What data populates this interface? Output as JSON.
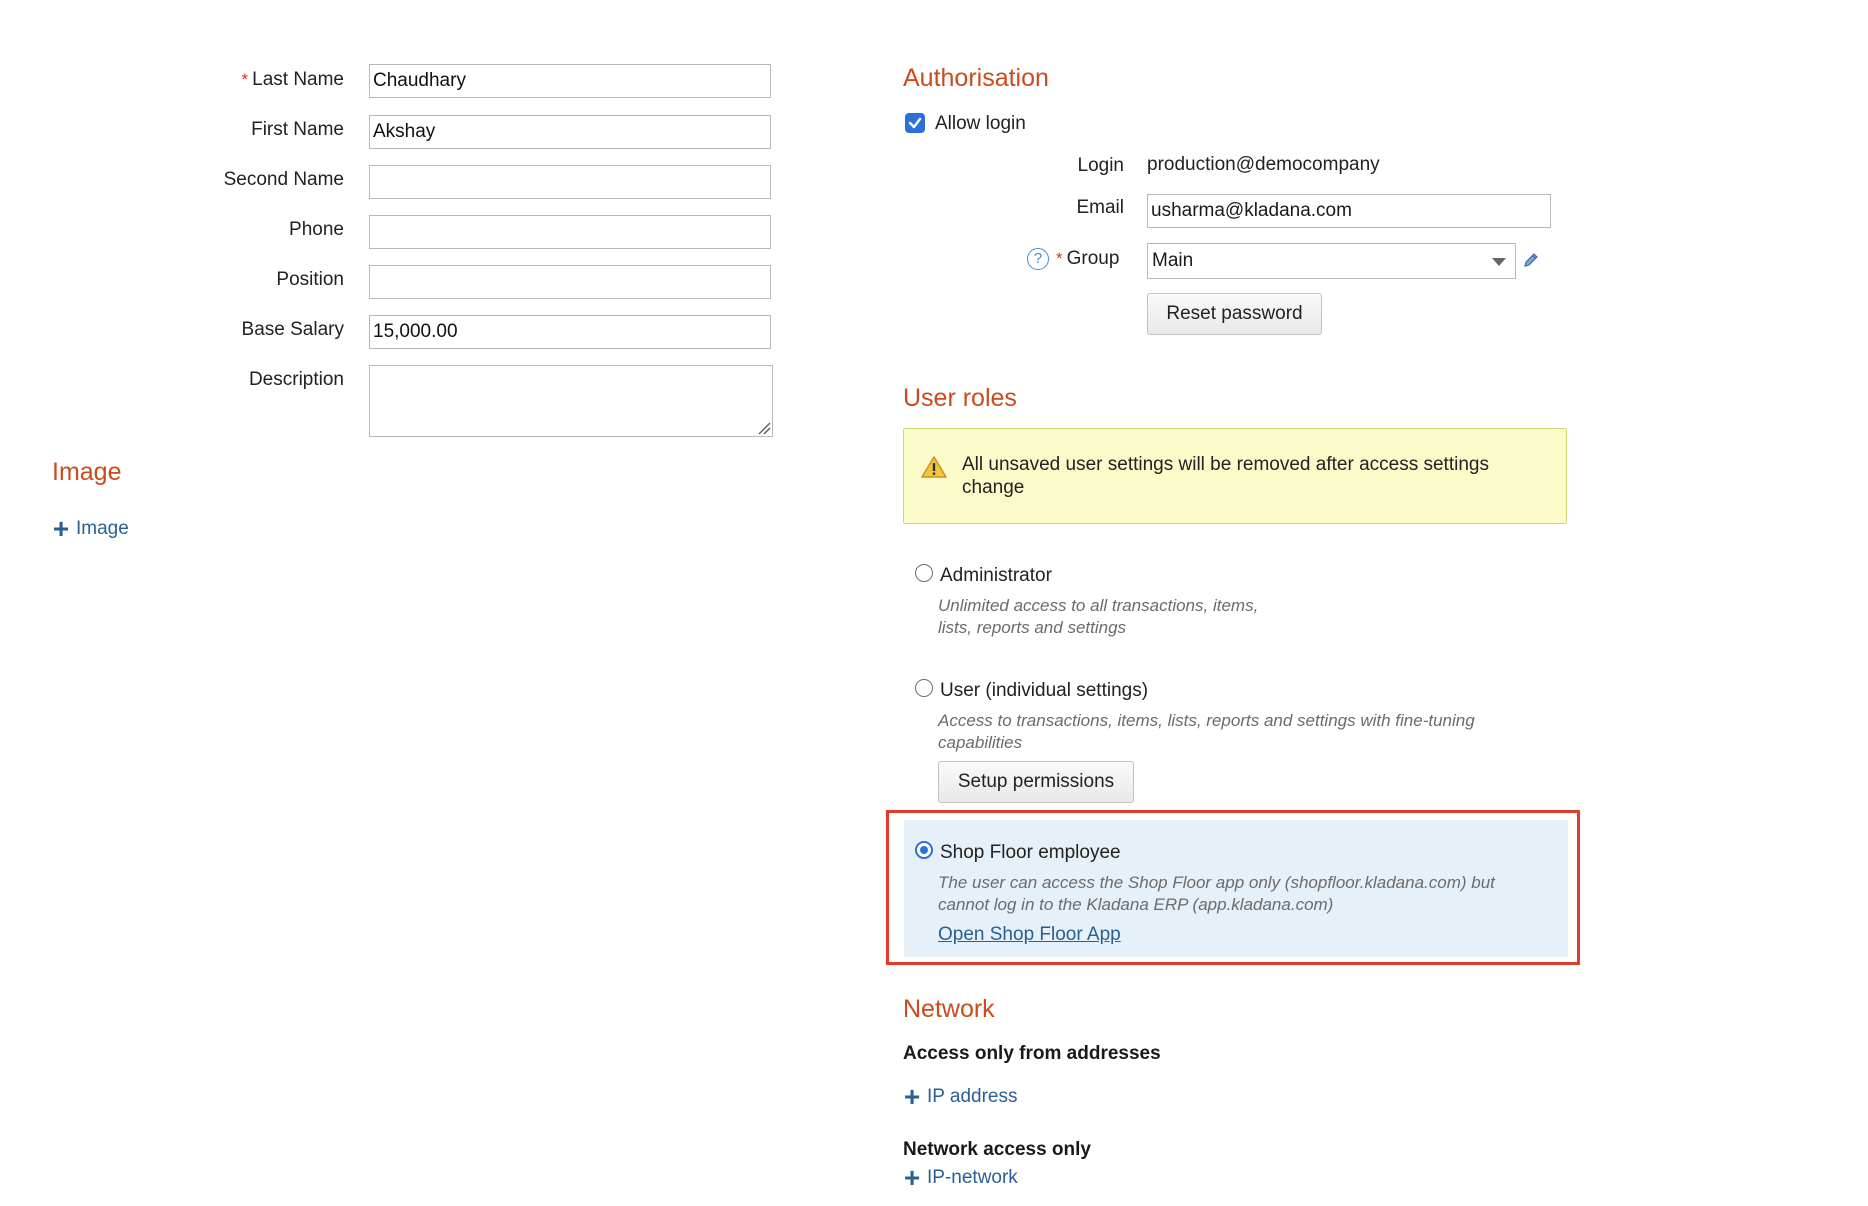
{
  "employee_form": {
    "last_name": {
      "label": "Last Name",
      "required_mark": "*",
      "value": "Chaudhary"
    },
    "first_name": {
      "label": "First Name",
      "value": "Akshay"
    },
    "second_name": {
      "label": "Second Name",
      "value": ""
    },
    "phone": {
      "label": "Phone",
      "value": ""
    },
    "position": {
      "label": "Position",
      "value": ""
    },
    "base_salary": {
      "label": "Base Salary",
      "value": "15,000.00"
    },
    "description": {
      "label": "Description",
      "value": ""
    }
  },
  "image_section": {
    "title": "Image",
    "add_label": "Image",
    "add_icon": "plus-icon"
  },
  "authorisation": {
    "title": "Authorisation",
    "allow_login": {
      "label": "Allow login",
      "checked": true
    },
    "login": {
      "label": "Login",
      "value": "production@democompany"
    },
    "email": {
      "label": "Email",
      "value": "usharma@kladana.com"
    },
    "group": {
      "label": "Group",
      "required_mark": "*",
      "selected": "Main",
      "help_icon": "question-circle-icon",
      "edit_icon": "pencil-icon"
    },
    "reset_password_label": "Reset password"
  },
  "user_roles": {
    "title": "User roles",
    "warning_icon": "warning-triangle-icon",
    "warning_text": "All unsaved user settings will be removed after access settings change",
    "roles": [
      {
        "title": "Administrator",
        "selected": false,
        "desc_lines": [
          "Unlimited access to all transactions, items,",
          "lists, reports and settings"
        ]
      },
      {
        "title": "User (individual settings)",
        "selected": false,
        "desc_lines": [
          "Access to transactions, items, lists, reports and settings with fine-tuning",
          "capabilities"
        ],
        "button_label": "Setup permissions"
      },
      {
        "title": "Shop Floor employee",
        "selected": true,
        "desc_lines": [
          "The user can access the Shop Floor app only (shopfloor.kladana.com) but",
          "cannot log in to the Kladana ERP (app.kladana.com)"
        ],
        "link_label": "Open Shop Floor App"
      }
    ]
  },
  "network": {
    "title": "Network",
    "access_addresses_label": "Access only from addresses",
    "add_ip_label": "IP address",
    "network_access_label": "Network access only",
    "add_network_label": "IP-network"
  },
  "colors": {
    "section_title": "#cc4b1d",
    "link": "#2a5f95",
    "accent": "#2a72d8",
    "warning_bg": "#fbfbc9",
    "highlight_bg": "#e6f0f8",
    "highlight_frame": "#e33b2b"
  }
}
